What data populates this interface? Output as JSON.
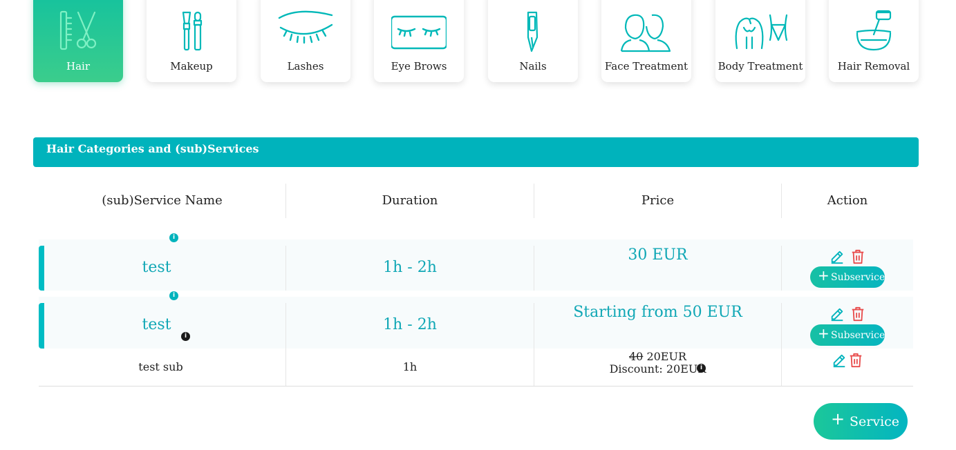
{
  "categories": [
    {
      "label": "Hair",
      "icon": "comb-scissors-icon",
      "active": true
    },
    {
      "label": "Makeup",
      "icon": "makeup-brush-icon",
      "active": false
    },
    {
      "label": "Lashes",
      "icon": "eye-lashes-icon",
      "active": false
    },
    {
      "label": "Eye Brows",
      "icon": "eyebrows-icon",
      "active": false
    },
    {
      "label": "Nails",
      "icon": "nail-file-icon",
      "active": false
    },
    {
      "label": "Face Treatment",
      "icon": "faces-icon",
      "active": false
    },
    {
      "label": "Body Treatment",
      "icon": "body-icon",
      "active": false
    },
    {
      "label": "Hair Removal",
      "icon": "wax-bowl-icon",
      "active": false
    }
  ],
  "section": {
    "title": "Hair Categories and (sub)Services"
  },
  "table": {
    "headers": [
      "(sub)Service Name",
      "Duration",
      "Price",
      "Action"
    ],
    "rows": [
      {
        "name": "test",
        "duration": "1h - 2h",
        "price": "30 EUR",
        "subservice_label": "Subservice"
      },
      {
        "name": "test",
        "duration": "1h - 2h",
        "price": "Starting from 50 EUR",
        "subservice_label": "Subservice"
      }
    ],
    "sub_rows": [
      {
        "name": "test sub",
        "duration": "1h",
        "old_price": "40",
        "price": "20EUR",
        "discount": "Discount: 20EUR"
      }
    ]
  },
  "add_service": {
    "label": "Service"
  },
  "colors": {
    "accent": "#00b3bc",
    "active_tile": "#2ec894",
    "delete": "#e84b4b"
  }
}
